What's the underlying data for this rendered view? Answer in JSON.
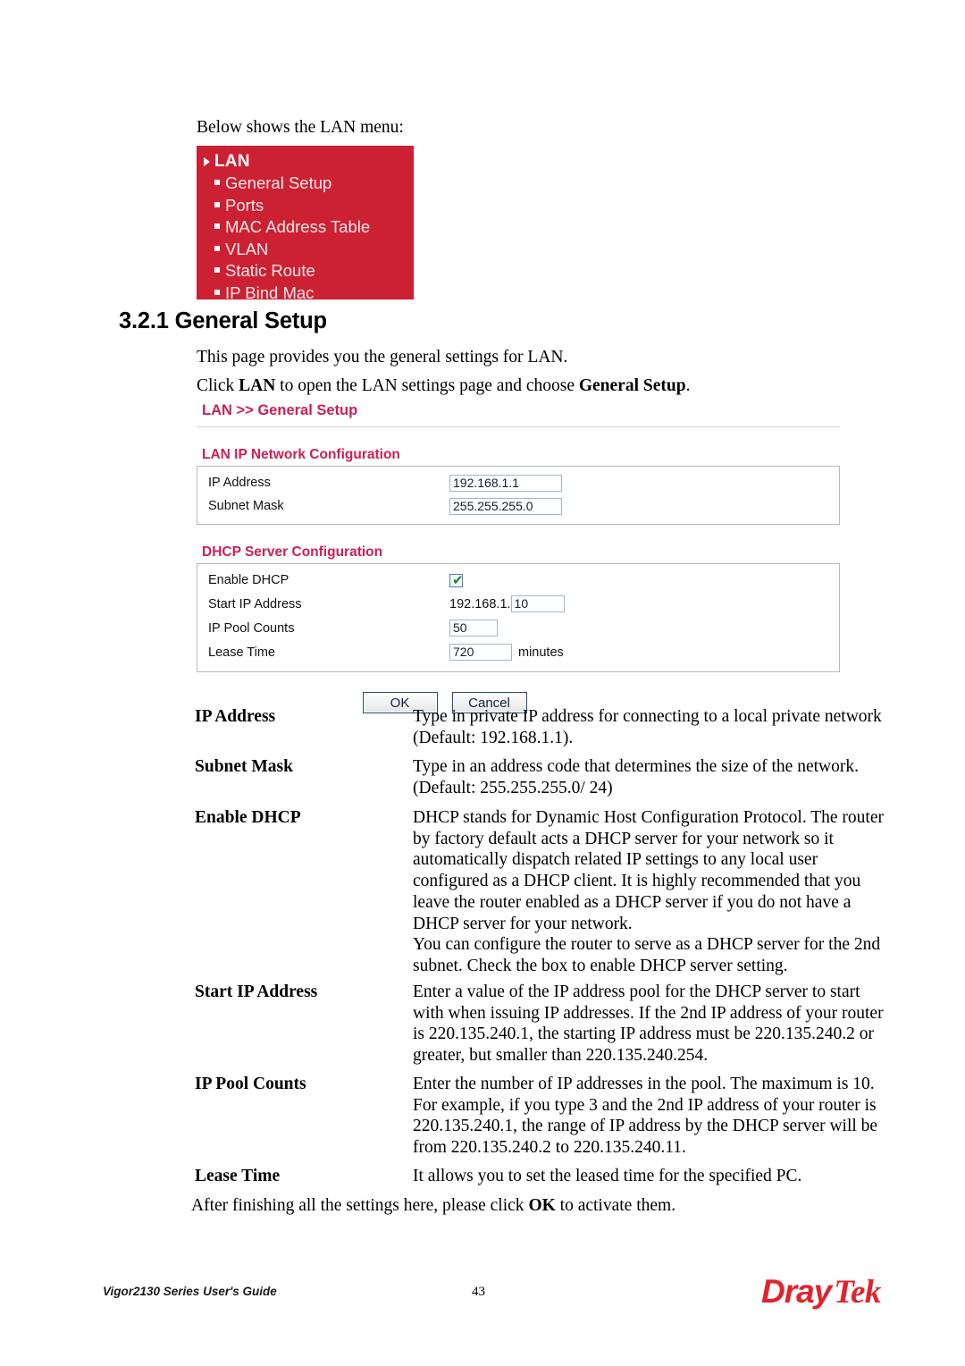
{
  "document": {
    "intro_line": "Below shows the LAN menu:",
    "section_number_title": "3.2.1 General Setup",
    "para_1": "This page provides you the general settings for LAN.",
    "closing_line_before": "After finishing all the settings here, please click ",
    "closing_line_bold": "OK",
    "closing_line_after": " to activate them."
  },
  "para_2": {
    "part1": "Click ",
    "bold1": "LAN",
    "part2": " to open the LAN settings page and choose ",
    "bold2": "General Setup",
    "part3": "."
  },
  "lan_menu": {
    "header_label": "LAN",
    "header_icon": "triangle-right-icon",
    "bullet_icon": "square-bullet-icon",
    "background_color": "#cc2132",
    "header_text_color": "#ffffff",
    "item_text_color": "#fde8ea",
    "items": [
      {
        "label": "General Setup"
      },
      {
        "label": "Ports"
      },
      {
        "label": "MAC Address Table"
      },
      {
        "label": "VLAN"
      },
      {
        "label": "Static Route"
      },
      {
        "label": "IP Bind Mac"
      }
    ]
  },
  "router_ui": {
    "breadcrumb": "LAN >> General Setup",
    "accent_color": "#cc2054",
    "lan_ip_section": {
      "title": "LAN IP Network Configuration",
      "rows": [
        {
          "label": "IP Address",
          "value": "192.168.1.1"
        },
        {
          "label": "Subnet Mask",
          "value": "255.255.255.0"
        }
      ]
    },
    "dhcp_section": {
      "title": "DHCP Server Configuration",
      "enable_dhcp_label": "Enable DHCP",
      "enable_dhcp_checked": true,
      "checkbox_tick": "✔",
      "start_ip_label": "Start IP Address",
      "start_ip_prefix": "192.168.1.",
      "start_ip_value": "10",
      "pool_counts_label": "IP Pool Counts",
      "pool_counts_value": "50",
      "lease_time_label": "Lease Time",
      "lease_time_value": "720",
      "lease_time_unit": "minutes"
    },
    "buttons": {
      "ok_label": "OK",
      "cancel_label": "Cancel"
    }
  },
  "definitions": [
    {
      "term": "IP Address",
      "desc": "Type in private IP address for connecting to a local private network (Default: 192.168.1.1)."
    },
    {
      "term": "Subnet Mask",
      "desc": "Type in an address code that determines the size of the network. (Default: 255.255.255.0/ 24)"
    },
    {
      "term": "Enable DHCP",
      "desc": "DHCP stands for Dynamic Host Configuration Protocol. The router by factory default acts a DHCP server for your network so it automatically dispatch related IP settings to any local user configured as a DHCP client. It is highly recommended that you leave the router enabled as a DHCP server if you do not have a DHCP server for your network.\nYou can configure the router to serve as a DHCP server for the 2nd subnet. Check the box to enable DHCP server setting."
    },
    {
      "term": "Start IP Address",
      "desc": "Enter a value of the IP address pool for the DHCP server to start with when issuing IP addresses. If the 2nd IP address of your router is 220.135.240.1, the starting IP address must be 220.135.240.2 or greater, but smaller than 220.135.240.254."
    },
    {
      "term": "IP Pool Counts",
      "desc": "Enter the number of IP addresses in the pool. The maximum is 10. For example, if you type 3 and the 2nd IP address of your router is 220.135.240.1, the range of IP address by the DHCP server will be from 220.135.240.2 to 220.135.240.11."
    },
    {
      "term": "Lease Time",
      "desc": "It allows you to set the leased time for the specified PC."
    }
  ],
  "footer": {
    "guide_title": "Vigor2130 Series User's Guide",
    "page_number": "43",
    "logo_part1": "Dray",
    "logo_part2": "Tek",
    "logo_color": "#e1232c"
  }
}
